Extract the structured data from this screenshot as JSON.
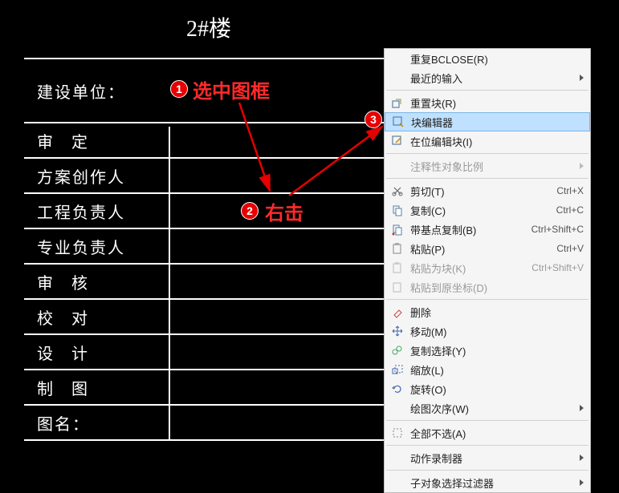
{
  "drawing": {
    "title": "2#楼",
    "rows": [
      {
        "label": "建设单位：",
        "spaced": false
      },
      {
        "label": "审   定",
        "spaced": false
      },
      {
        "label": "方案创作人",
        "spaced": false
      },
      {
        "label": "工程负责人",
        "spaced": false
      },
      {
        "label": "专业负责人",
        "spaced": false
      },
      {
        "label": "审   核",
        "spaced": false
      },
      {
        "label": "校   对",
        "spaced": false
      },
      {
        "label": "设   计",
        "spaced": false
      },
      {
        "label": "制   图",
        "spaced": false
      },
      {
        "label": "图名：",
        "spaced": false
      }
    ]
  },
  "annotations": {
    "step1": {
      "num": "1",
      "text": "选中图框"
    },
    "step2": {
      "num": "2",
      "text": "右击"
    },
    "step3": {
      "num": "3"
    }
  },
  "context_menu": {
    "groups": [
      [
        {
          "label": "重复BCLOSE(R)",
          "icon": null
        },
        {
          "label": "最近的输入",
          "icon": null,
          "sub": true
        }
      ],
      [
        {
          "label": "重置块(R)",
          "icon": "reset-block"
        },
        {
          "label": "块编辑器",
          "icon": "block-editor",
          "highlight": true
        },
        {
          "label": "在位编辑块(I)",
          "icon": "edit-inplace"
        }
      ],
      [
        {
          "label": "注释性对象比例",
          "icon": null,
          "sub": true,
          "disabled": true
        }
      ],
      [
        {
          "label": "剪切(T)",
          "icon": "cut",
          "shortcut": "Ctrl+X"
        },
        {
          "label": "复制(C)",
          "icon": "copy",
          "shortcut": "Ctrl+C"
        },
        {
          "label": "带基点复制(B)",
          "icon": "copy-base",
          "shortcut": "Ctrl+Shift+C"
        },
        {
          "label": "粘贴(P)",
          "icon": "paste",
          "shortcut": "Ctrl+V"
        },
        {
          "label": "粘贴为块(K)",
          "icon": "paste-block",
          "shortcut": "Ctrl+Shift+V",
          "disabled": true
        },
        {
          "label": "粘贴到原坐标(D)",
          "icon": "paste-coord",
          "disabled": true
        }
      ],
      [
        {
          "label": "删除",
          "icon": "erase"
        },
        {
          "label": "移动(M)",
          "icon": "move"
        },
        {
          "label": "复制选择(Y)",
          "icon": "copy-sel"
        },
        {
          "label": "缩放(L)",
          "icon": "scale"
        },
        {
          "label": "旋转(O)",
          "icon": "rotate"
        },
        {
          "label": "绘图次序(W)",
          "icon": null,
          "sub": true
        }
      ],
      [
        {
          "label": "全部不选(A)",
          "icon": "deselect"
        }
      ],
      [
        {
          "label": "动作录制器",
          "icon": null,
          "sub": true
        }
      ],
      [
        {
          "label": "子对象选择过滤器",
          "icon": null,
          "sub": true
        }
      ]
    ]
  },
  "colors": {
    "annotation_red": "#e60000",
    "highlight_bg": "#bfe0ff"
  }
}
